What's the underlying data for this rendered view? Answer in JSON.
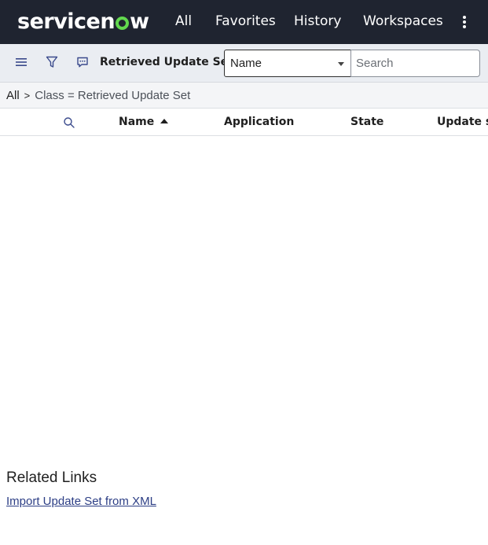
{
  "brand": {
    "logo_text_before": "servicen",
    "logo_text_after": "w",
    "accent_color": "#62d84e",
    "nav_bg": "#1f2430"
  },
  "nav": {
    "items": [
      {
        "label": "All"
      },
      {
        "label": "Favorites"
      },
      {
        "label": "History"
      },
      {
        "label": "Workspaces"
      }
    ],
    "more_icon": "vertical-ellipsis-icon"
  },
  "toolbar": {
    "menu_icon": "hamburger-icon",
    "filter_icon": "funnel-icon",
    "comment_icon": "chat-bubble-icon",
    "list_title": "Retrieved Update Sets",
    "search_field_selected": "Name",
    "search_placeholder": "Search"
  },
  "breadcrumb": {
    "root": "All",
    "separator": ">",
    "condition": "Class = Retrieved Update Set"
  },
  "table": {
    "columns": [
      {
        "label": "Name",
        "sorted": "ascending"
      },
      {
        "label": "Application"
      },
      {
        "label": "State"
      },
      {
        "label": "Update so"
      }
    ],
    "rows": []
  },
  "related": {
    "title": "Related Links",
    "links": [
      {
        "label": "Import Update Set from XML"
      }
    ]
  }
}
